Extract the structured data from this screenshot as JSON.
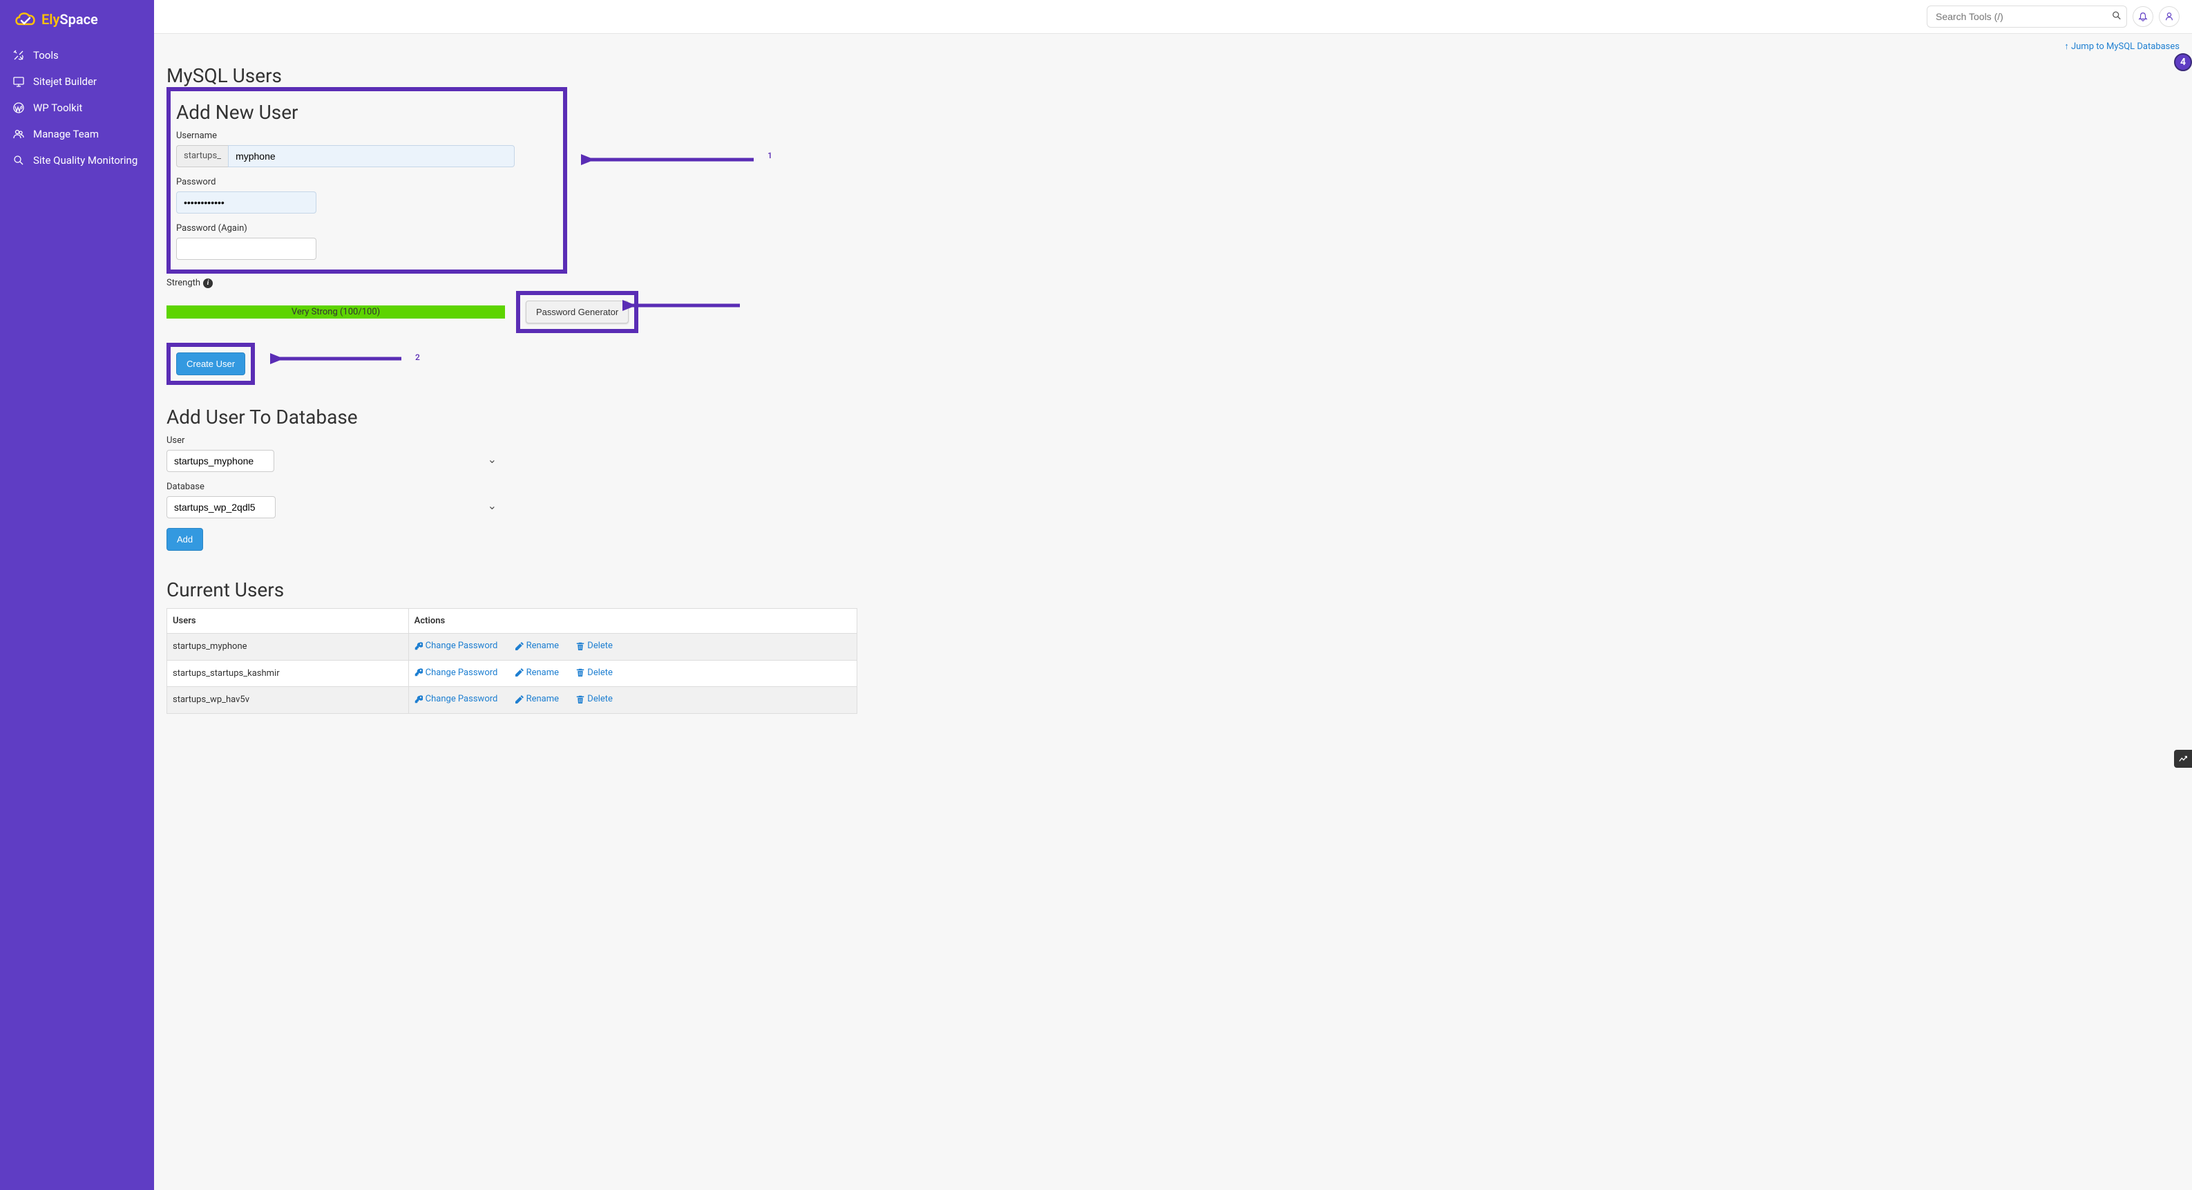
{
  "brand": {
    "part1": "Ely",
    "part2": "Space"
  },
  "nav": {
    "tools": "Tools",
    "sitejet": "Sitejet Builder",
    "wptoolkit": "WP Toolkit",
    "manageteam": "Manage Team",
    "sitequality": "Site Quality Monitoring"
  },
  "topbar": {
    "searchPlaceholder": "Search Tools (/)"
  },
  "jumpLink": "Jump to MySQL Databases",
  "badgeNumber": "4",
  "page": {
    "title": "MySQL Users",
    "addNewUser": {
      "heading": "Add New User",
      "usernameLabel": "Username",
      "usernamePrefix": "startups_",
      "usernameValue": "myphone",
      "passwordLabel": "Password",
      "passwordValue": "••••••••••••",
      "passwordAgainLabel": "Password (Again)",
      "passwordAgainValue": "",
      "strengthLabel": "Strength",
      "strengthText": "Very Strong (100/100)",
      "passwordGeneratorBtn": "Password Generator",
      "createUserBtn": "Create User"
    },
    "addUserToDb": {
      "heading": "Add User To Database",
      "userLabel": "User",
      "userValue": "startups_myphone",
      "databaseLabel": "Database",
      "databaseValue": "startups_wp_2qdl5",
      "addBtn": "Add"
    },
    "currentUsers": {
      "heading": "Current Users",
      "colUsers": "Users",
      "colActions": "Actions",
      "changePassword": "Change Password",
      "rename": "Rename",
      "delete": "Delete",
      "rows": [
        "startups_myphone",
        "startups_startups_kashmir",
        "startups_wp_hav5v"
      ]
    }
  },
  "annotations": {
    "one": "1",
    "two": "2"
  }
}
